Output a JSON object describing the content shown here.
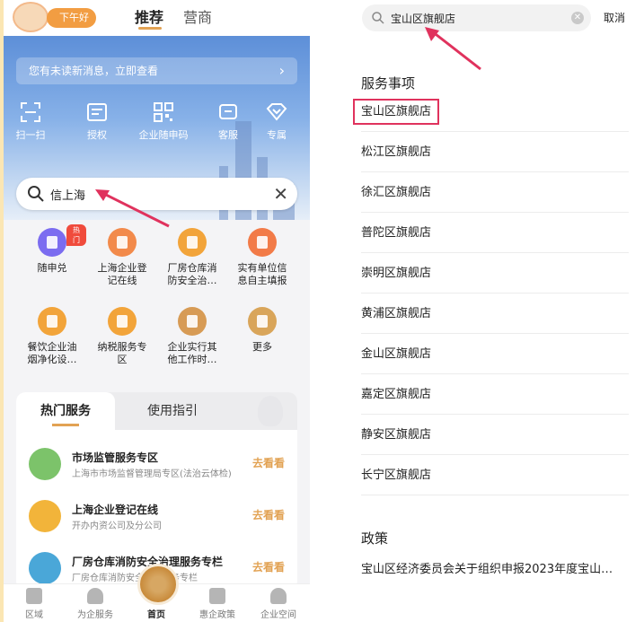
{
  "left_panel": {
    "greeting": "下午好",
    "top_tabs": [
      "推荐",
      "营商"
    ],
    "banner_notice": "您有未读新消息，立即查看",
    "quick_actions": [
      {
        "label": "扫一扫",
        "icon": "scan-icon"
      },
      {
        "label": "授权",
        "icon": "authorize-icon"
      },
      {
        "label": "企业随申码",
        "icon": "qrcode-icon"
      },
      {
        "label": "客服",
        "icon": "customer-service-icon"
      },
      {
        "label": "专属",
        "icon": "diamond-icon"
      }
    ],
    "search": {
      "value": "信上海",
      "clear_icon": "close-icon"
    },
    "grid": [
      {
        "label": "随申兑",
        "badge": "热门",
        "color": "#7b6cf0"
      },
      {
        "label": "上海企业登\n记在线",
        "color": "#f28a4b"
      },
      {
        "label": "厂房仓库消\n防安全治…",
        "color": "#f2a43a"
      },
      {
        "label": "实有单位信\n息自主填报",
        "color": "#f27b48"
      },
      {
        "label": "餐饮企业油\n烟净化设…",
        "color": "#f2a43a"
      },
      {
        "label": "纳税服务专\n区",
        "color": "#f2a43a"
      },
      {
        "label": "企业实行其\n他工作时…",
        "color": "#d79b55"
      },
      {
        "label": "更多",
        "color": "#d9a55a"
      }
    ],
    "service_tabs": [
      "热门服务",
      "使用指引"
    ],
    "services": [
      {
        "title": "市场监管服务专区",
        "subtitle": "上海市市场监督管理局专区(法治云体检)",
        "action": "去看看",
        "color": "#7cc36a"
      },
      {
        "title": "上海企业登记在线",
        "subtitle": "开办内资公司及分公司",
        "action": "去看看",
        "color": "#f2b43a"
      },
      {
        "title": "厂房仓库消防安全治理服务专栏",
        "subtitle": "厂房仓库消防安全治理服务专栏",
        "action": "去看看",
        "color": "#4aa7d8"
      }
    ],
    "bottom_nav": [
      "区域",
      "为企服务",
      "首页",
      "惠企政策",
      "企业空间"
    ]
  },
  "right_panel": {
    "search_value": "宝山区旗舰店",
    "cancel_label": "取消",
    "section_services": "服务事项",
    "results": [
      "宝山区旗舰店",
      "松江区旗舰店",
      "徐汇区旗舰店",
      "普陀区旗舰店",
      "崇明区旗舰店",
      "黄浦区旗舰店",
      "金山区旗舰店",
      "嘉定区旗舰店",
      "静安区旗舰店",
      "长宁区旗舰店"
    ],
    "section_policy": "政策",
    "policy_item": "宝山区经济委员会关于组织申报2023年度宝山…"
  },
  "colors": {
    "accent": "#e2a253",
    "highlight": "#e0325d"
  }
}
